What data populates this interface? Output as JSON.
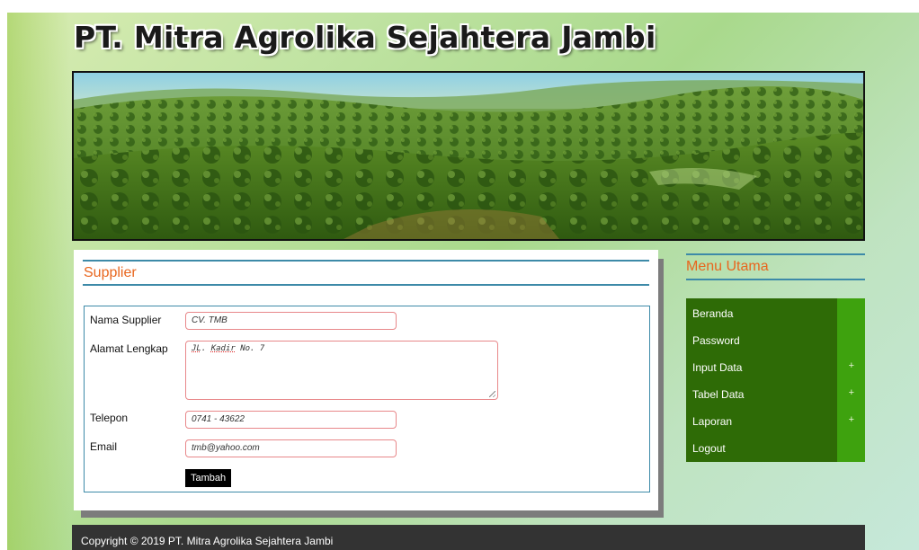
{
  "site": {
    "title": "PT. Mitra Agrolika Sejahtera Jambi"
  },
  "banner": {
    "alt": "oil-palm-plantation-banner"
  },
  "content": {
    "section_title": "Supplier",
    "form": {
      "nama_label": "Nama Supplier",
      "nama_value": "CV. TMB",
      "alamat_label": "Alamat Lengkap",
      "alamat_value_part1": "JL",
      "alamat_value_part2": ". ",
      "alamat_value_part3": "Kadir",
      "alamat_value_part4": " No. 7",
      "telepon_label": "Telepon",
      "telepon_value": "0741 - 43622",
      "email_label": "Email",
      "email_value": "tmb@yahoo.com",
      "submit_label": "Tambah"
    }
  },
  "sidebar": {
    "title": "Menu Utama",
    "items": [
      {
        "label": "Beranda",
        "has_submenu": false
      },
      {
        "label": "Password",
        "has_submenu": false
      },
      {
        "label": "Input Data",
        "has_submenu": true,
        "expand": "+"
      },
      {
        "label": "Tabel Data",
        "has_submenu": true,
        "expand": "+"
      },
      {
        "label": "Laporan",
        "has_submenu": true,
        "expand": "+"
      },
      {
        "label": "Logout",
        "has_submenu": false
      }
    ]
  },
  "footer": {
    "text": "Copyright © 2019 PT. Mitra Agrolika Sejahtera Jambi"
  },
  "colors": {
    "accent_orange": "#e8661e",
    "rule_blue": "#3d8aa8",
    "menu_green": "#2e6b06",
    "menu_strip_green": "#3ea20e",
    "footer_dark": "#333333"
  }
}
